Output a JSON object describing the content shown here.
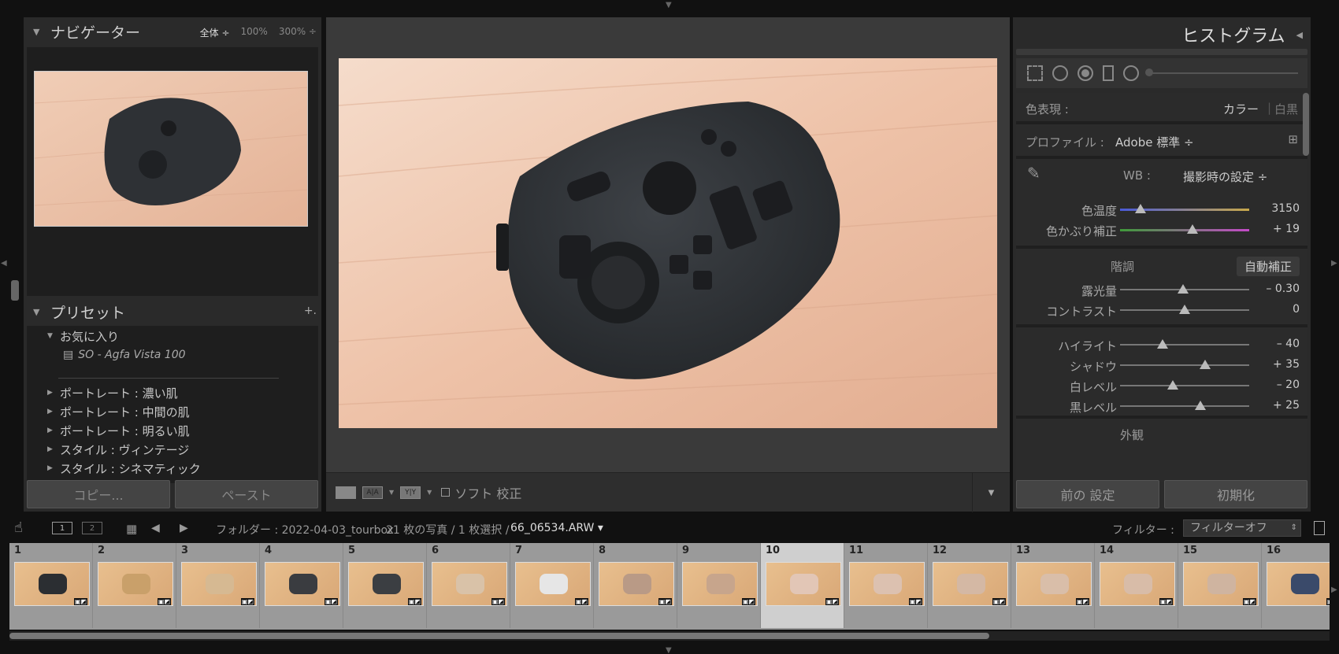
{
  "navigator": {
    "title": "ナビゲーター",
    "zoom_fit": "全体 ÷",
    "zoom_100": "100%",
    "zoom_300": "300% ÷"
  },
  "presets": {
    "title": "プリセット",
    "favorites": "お気に入り",
    "favorite_item": "SO - Agfa Vista 100",
    "groups": [
      "ポートレート : 濃い肌",
      "ポートレート : 中間の肌",
      "ポートレート : 明るい肌",
      "スタイル : ヴィンテージ",
      "スタイル : シネマティック"
    ]
  },
  "left_buttons": {
    "copy": "コピー...",
    "paste": "ペースト"
  },
  "toolbar": {
    "soft_proof": "ソフト 校正",
    "compare": "A|A",
    "survey": "Y|Y"
  },
  "histogram": {
    "title": "ヒストグラム"
  },
  "develop": {
    "treatment_label": "色表現 :",
    "treatment_color": "カラー",
    "treatment_sep": "|",
    "treatment_bw": "白黒",
    "profile_label": "プロファイル :",
    "profile_value": "Adobe 標準 ÷",
    "wb_label": "WB :",
    "wb_value": "撮影時の設定 ÷",
    "tone_label": "階調",
    "auto_label": "自動補正",
    "presence_label": "外観",
    "sliders": [
      {
        "label": "色温度",
        "value": "3150",
        "pos": 0.16
      },
      {
        "label": "色かぶり補正",
        "value": "+ 19",
        "pos": 0.56
      },
      {
        "label": "露光量",
        "value": "– 0.30",
        "pos": 0.49
      },
      {
        "label": "コントラスト",
        "value": "0",
        "pos": 0.5
      },
      {
        "label": "ハイライト",
        "value": "– 40",
        "pos": 0.33
      },
      {
        "label": "シャドウ",
        "value": "+ 35",
        "pos": 0.66
      },
      {
        "label": "白レベル",
        "value": "– 20",
        "pos": 0.41
      },
      {
        "label": "黒レベル",
        "value": "+ 25",
        "pos": 0.62
      }
    ]
  },
  "right_buttons": {
    "previous": "前の 設定",
    "reset": "初期化"
  },
  "filmstrip_bar": {
    "page1": "1",
    "page2": "2",
    "folder": "フォルダー : 2022-04-03_tourbox",
    "count": "21 枚の写真 / 1 枚選択 /",
    "filename": "66_06534.ARW ▾",
    "filter_label": "フィルター :",
    "filter_value": "フィルターオフ"
  },
  "filmstrip": {
    "cells": [
      "1",
      "2",
      "3",
      "4",
      "5",
      "6",
      "7",
      "8",
      "9",
      "10",
      "11",
      "12",
      "13",
      "14",
      "15",
      "16"
    ],
    "selected": 10
  },
  "colors": {
    "accent": "#cfcfcf",
    "panel": "#2a2a2a",
    "wood": "#e8b9a2"
  }
}
